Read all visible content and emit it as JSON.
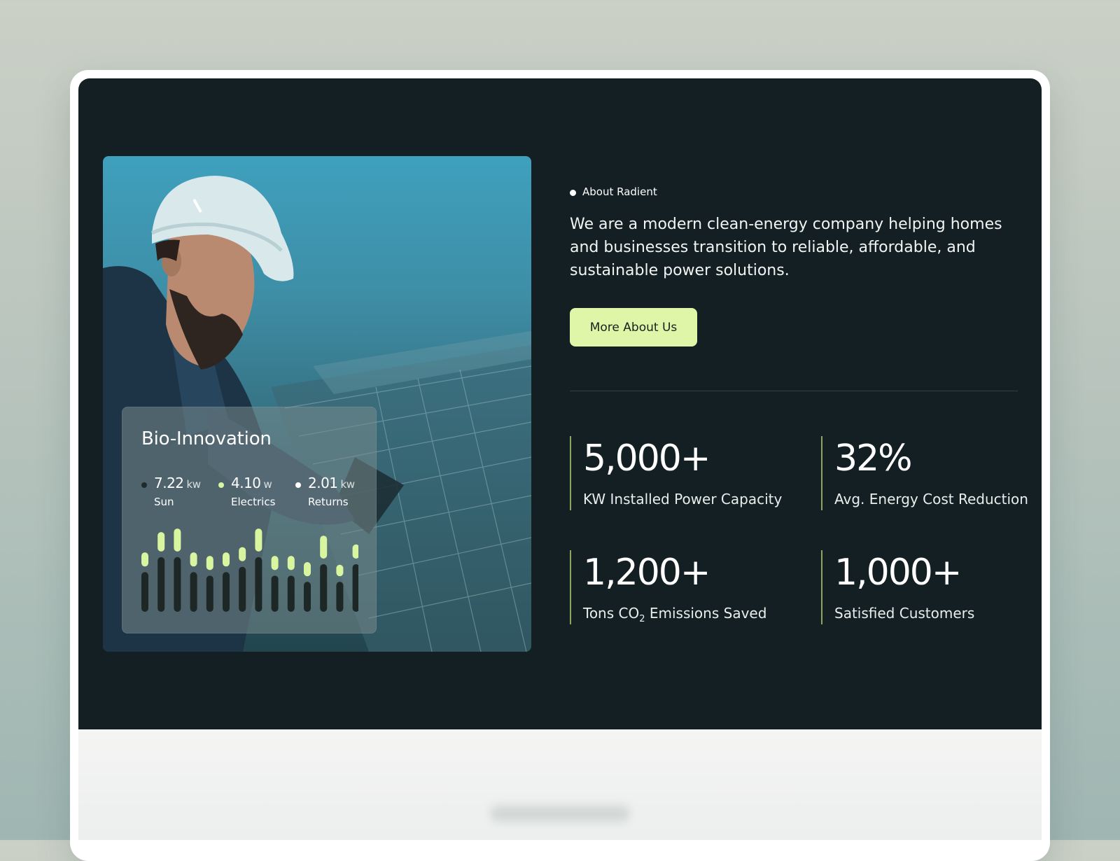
{
  "about": {
    "eyebrow": "About Radient",
    "intro": "We are a modern clean-energy company helping homes and businesses transition to reliable, affordable, and sustainable power solutions.",
    "cta_label": "More About Us"
  },
  "card": {
    "title": "Bio-Innovation",
    "metrics": [
      {
        "value": "7.22",
        "unit": "kw",
        "label": "Sun",
        "dot_color": "#1f2a2a"
      },
      {
        "value": "4.10",
        "unit": "w",
        "label": "Electrics",
        "dot_color": "#d8f59f"
      },
      {
        "value": "2.01",
        "unit": "kw",
        "label": "Returns",
        "dot_color": "#ffffff"
      }
    ],
    "bar_levels": [
      {
        "dark": 0.45,
        "light": 0.16
      },
      {
        "dark": 0.62,
        "light": 0.22
      },
      {
        "dark": 0.62,
        "light": 0.26
      },
      {
        "dark": 0.45,
        "light": 0.16
      },
      {
        "dark": 0.41,
        "light": 0.16
      },
      {
        "dark": 0.45,
        "light": 0.16
      },
      {
        "dark": 0.51,
        "light": 0.16
      },
      {
        "dark": 0.62,
        "light": 0.26
      },
      {
        "dark": 0.41,
        "light": 0.16
      },
      {
        "dark": 0.41,
        "light": 0.16
      },
      {
        "dark": 0.34,
        "light": 0.16
      },
      {
        "dark": 0.54,
        "light": 0.26
      },
      {
        "dark": 0.34,
        "light": 0.13
      },
      {
        "dark": 0.54,
        "light": 0.16
      }
    ]
  },
  "stats": [
    {
      "value": "5,000+",
      "caption": "KW Installed Power Capacity"
    },
    {
      "value": "32%",
      "caption": "Avg. Energy Cost Reduction"
    },
    {
      "value": "1,200+",
      "caption_pre": "Tons CO",
      "caption_sub": "2",
      "caption_post": " Emissions Saved"
    },
    {
      "value": "1,000+",
      "caption": "Satisfied Customers"
    }
  ],
  "colors": {
    "background": "#131f22",
    "accent": "#dff5a8",
    "bar_light": "#d8f59f",
    "bar_dark": "#1c2726",
    "stat_border": "#8aa85d"
  }
}
